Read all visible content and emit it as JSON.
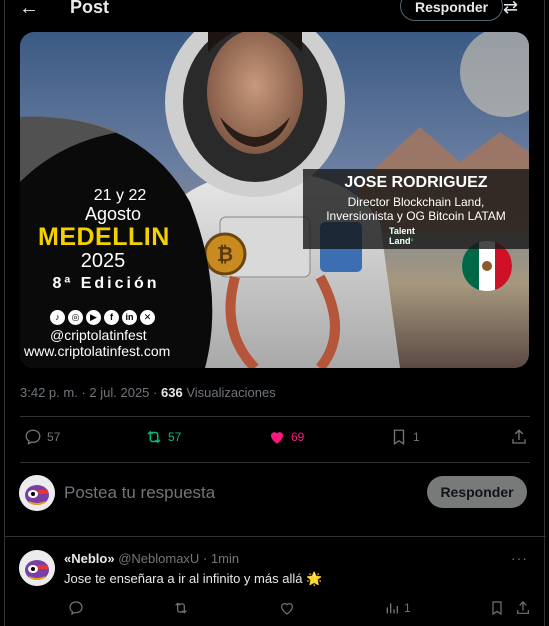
{
  "header": {
    "back_icon": "arrow-left-icon",
    "title": "Post",
    "reply_label": "Responder",
    "settings_icon": "sliders-icon"
  },
  "media": {
    "event": {
      "date": "21 y 22",
      "month": "Agosto",
      "city": "MEDELLIN",
      "year": "2025",
      "edition": "8ª Edición",
      "handle": "@criptolatinfest",
      "website": "www.criptolatinfest.com"
    },
    "speaker": {
      "name": "JOSE RODRIGUEZ",
      "role_line1": "Director Blockchain Land,",
      "role_line2": "Inversionista y OG Bitcoin LATAM",
      "sponsor_line1": "Talent",
      "sponsor_line2": "Land"
    }
  },
  "post_meta": {
    "time": "3:42 p. m.",
    "separator": "·",
    "date": "2 jul. 2025",
    "views_count": "636",
    "views_label": "Visualizaciones"
  },
  "actions": {
    "replies": "57",
    "reposts": "57",
    "likes": "69",
    "bookmarks": "1",
    "repost_color": "#00ba7c",
    "like_color": "#f91880"
  },
  "composer": {
    "placeholder": "Postea tu respuesta",
    "button_label": "Responder"
  },
  "reply": {
    "name": "«Neblo»",
    "handle": "@NeblomaxU",
    "separator": "·",
    "time": "1min",
    "text": "Jose te enseñara a ir al infinito y más allá 🌟",
    "views": "1"
  }
}
